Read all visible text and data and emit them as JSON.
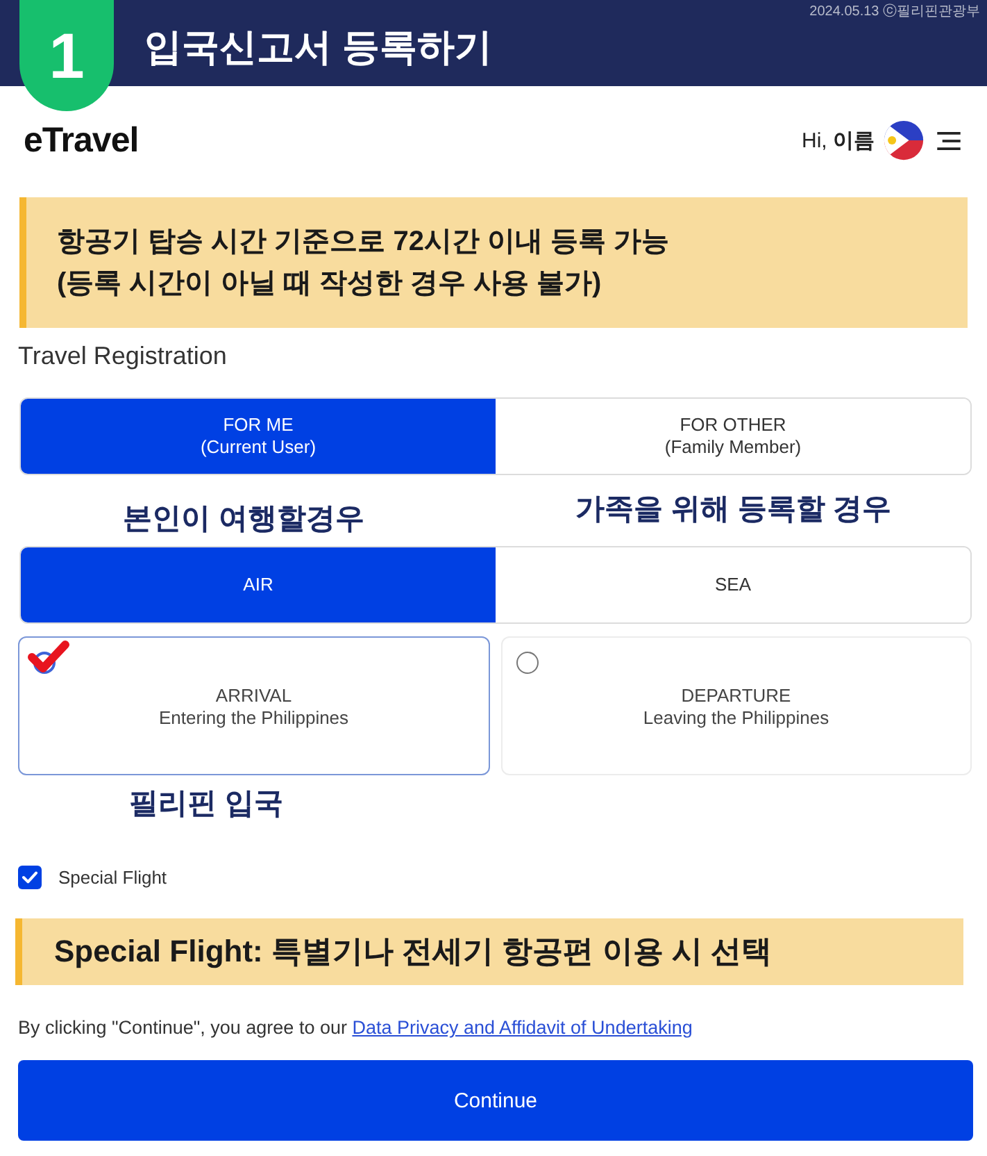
{
  "header": {
    "step": "1",
    "title": "입국신고서 등록하기",
    "credit": "2024.05.13 ⓒ필리핀관광부"
  },
  "app_bar": {
    "logo": "eTravel",
    "greeting": "Hi, **이름**"
  },
  "notice": {
    "lines": [
      "항공기 탑승 시간 기준으로 72시간 이내 등록 가능",
      "(등록 시간이 아닐 때 작성한 경우 사용 불가)"
    ]
  },
  "section_title": "Travel Registration",
  "traveler_toggle": [
    {
      "label": "FOR ME",
      "sublabel": "(Current User)",
      "selected": true
    },
    {
      "label": "FOR OTHER",
      "sublabel": "(Family Member)",
      "selected": false
    }
  ],
  "traveler_notes": [
    "본인이 여행할경우",
    "가족을 위해 등록할 경우"
  ],
  "mode_toggle": [
    {
      "label": "AIR",
      "selected": true
    },
    {
      "label": "SEA",
      "selected": false
    }
  ],
  "direction_options": [
    {
      "label": "ARRIVAL",
      "sublabel": "Entering the Philippines",
      "selected": true
    },
    {
      "label": "DEPARTURE",
      "sublabel": "Leaving the Philippines",
      "selected": false
    }
  ],
  "direction_note": "필리핀 입국",
  "special_flight": {
    "label": "Special Flight",
    "checked": true
  },
  "special_flight_note": "Special Flight: 특별기나 전세기 항공편 이용 시 선택",
  "agreement": {
    "text": "By clicking \"Continue\", you agree to our",
    "link": "Data Privacy and Affidavit of Undertaking"
  },
  "continue_button": "Continue"
}
